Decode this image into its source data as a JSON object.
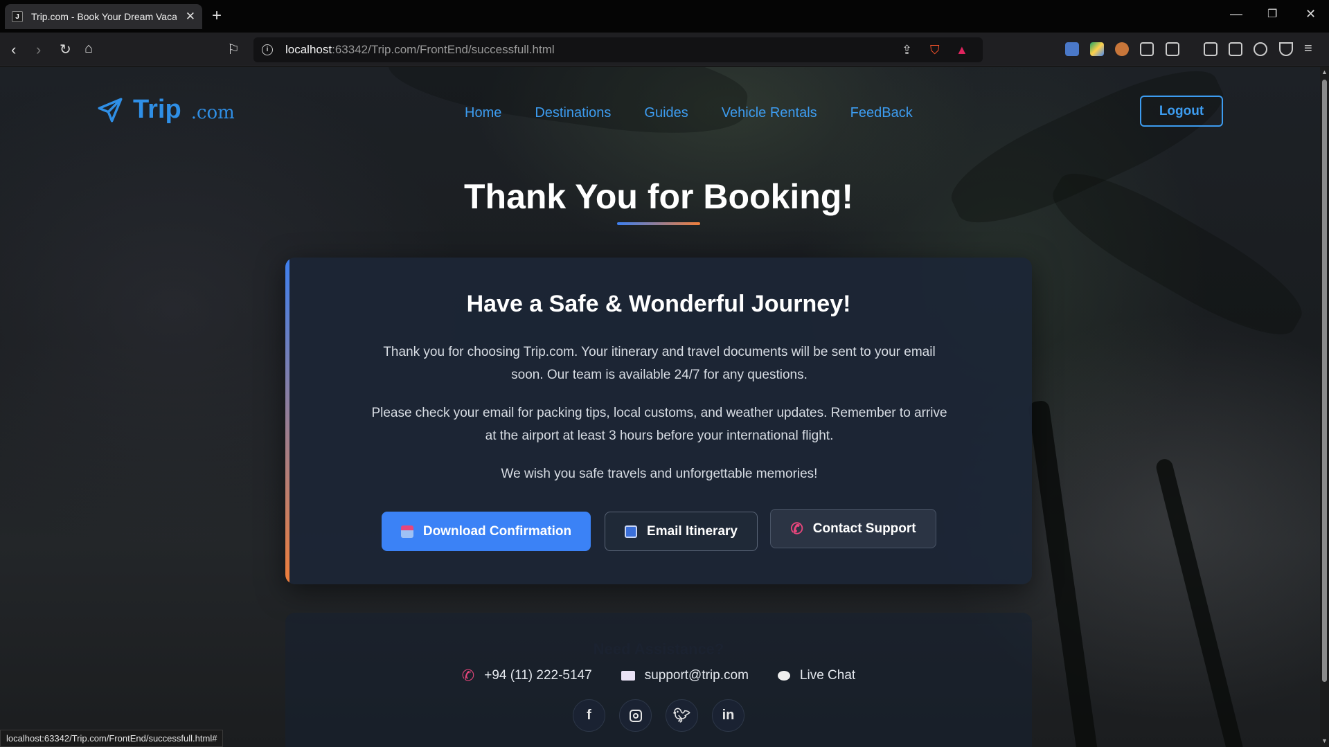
{
  "browser": {
    "tab_title": "Trip.com - Book Your Dream Vacation",
    "url_host": "localhost",
    "url_path": ":63342/Trip.com/FrontEnd/successfull.html",
    "status_url": "localhost:63342/Trip.com/FrontEnd/successfull.html#"
  },
  "header": {
    "logo_name": "Trip",
    "logo_suffix": ".com",
    "nav": [
      "Home",
      "Destinations",
      "Guides",
      "Vehicle Rentals",
      "FeedBack"
    ],
    "logout_label": "Logout"
  },
  "hero": {
    "title": "Thank You for Booking!"
  },
  "card": {
    "heading": "Have a Safe & Wonderful Journey!",
    "paragraph_1": "Thank you for choosing Trip.com. Your itinerary and travel documents will be sent to your email soon. Our team is available 24/7 for any questions.",
    "paragraph_2": "Please check your email for packing tips, local customs, and weather updates. Remember to arrive at the airport at least 3 hours before your international flight.",
    "paragraph_3": "We wish you safe travels and unforgettable memories!",
    "buttons": {
      "download": "Download Confirmation",
      "email": "Email Itinerary",
      "support": "Contact Support"
    }
  },
  "assistance": {
    "heading": "Need Assistance?",
    "phone": "+94 (11) 222-5147",
    "email": "support@trip.com",
    "chat": "Live Chat",
    "socials": [
      "facebook-icon",
      "instagram-icon",
      "twitter-icon",
      "linkedin-icon"
    ]
  },
  "colors": {
    "accent_blue": "#3b82f6",
    "link_blue": "#3d9cf0",
    "accent_orange": "#f07e3a",
    "phone_pink": "#e8467c"
  }
}
